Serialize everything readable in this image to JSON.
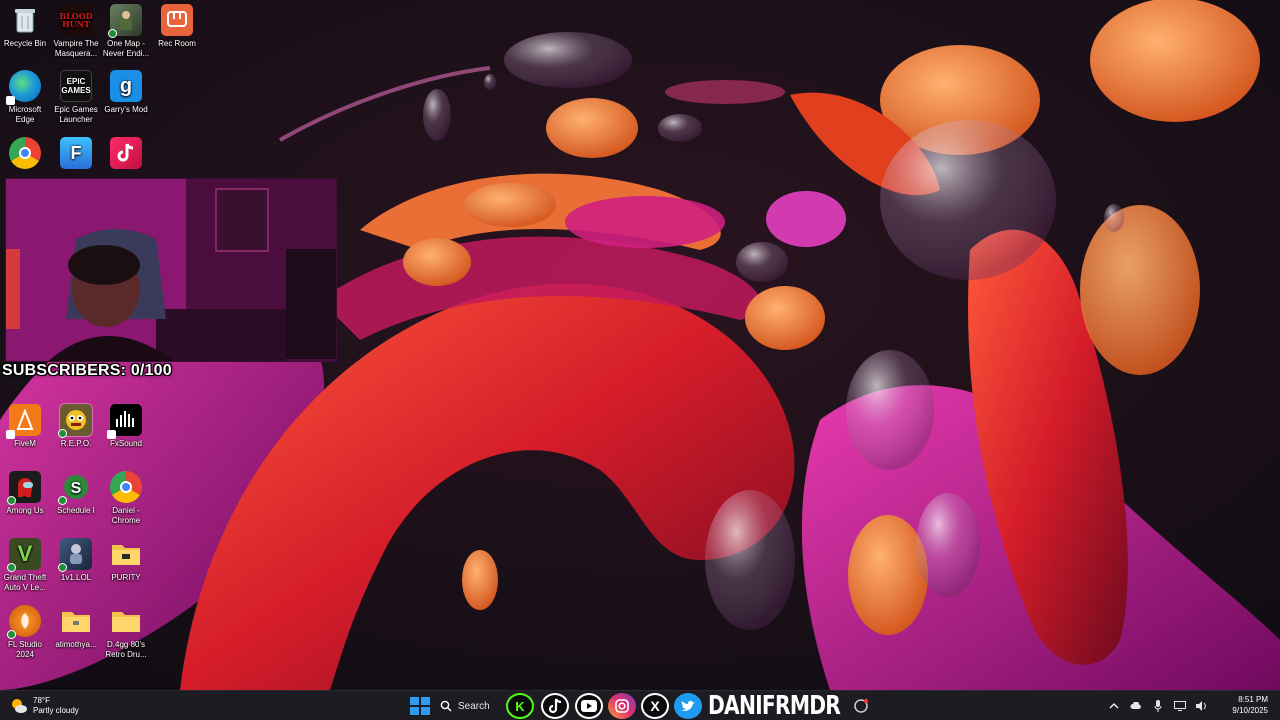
{
  "desktop": {
    "icons": [
      {
        "label": "Recycle Bin"
      },
      {
        "label": "Vampire The Masquera..."
      },
      {
        "label": "One Map - Never Endi..."
      },
      {
        "label": "Rec Room"
      },
      {
        "label": "Microsoft Edge"
      },
      {
        "label": "Epic Games Launcher"
      },
      {
        "label": "Garry's Mod"
      },
      {
        "label": "FiveM"
      },
      {
        "label": "R.E.P.O."
      },
      {
        "label": "FxSound"
      },
      {
        "label": "Among Us"
      },
      {
        "label": "Schedule I"
      },
      {
        "label": "Daniel - Chrome"
      },
      {
        "label": "Grand Theft Auto V Le..."
      },
      {
        "label": "1v1.LOL"
      },
      {
        "label": "PURITY"
      },
      {
        "label": "FL Studio 2024"
      },
      {
        "label": "atimothya..."
      },
      {
        "label": "D.4gg 80's Retro Dru..."
      }
    ],
    "tile_text": {
      "blood_hunt": "BLOOD HUNT",
      "epic": "EPIC GAMES",
      "garrys": "g",
      "fortnite": "F"
    }
  },
  "overlay": {
    "subscribers": "SUBSCRIBERS: 0/100"
  },
  "taskbar": {
    "weather_temp": "78°F",
    "weather_desc": "Partly cloudy",
    "search_label": "Search",
    "brand": "DANIFRMDR",
    "time": "8:51 PM",
    "date": "9/10/2025"
  },
  "colors": {
    "accent": "#2d9cf0",
    "kick": "#53fc18",
    "youtube": "#ff0000",
    "twitter": "#1d9bf0"
  }
}
